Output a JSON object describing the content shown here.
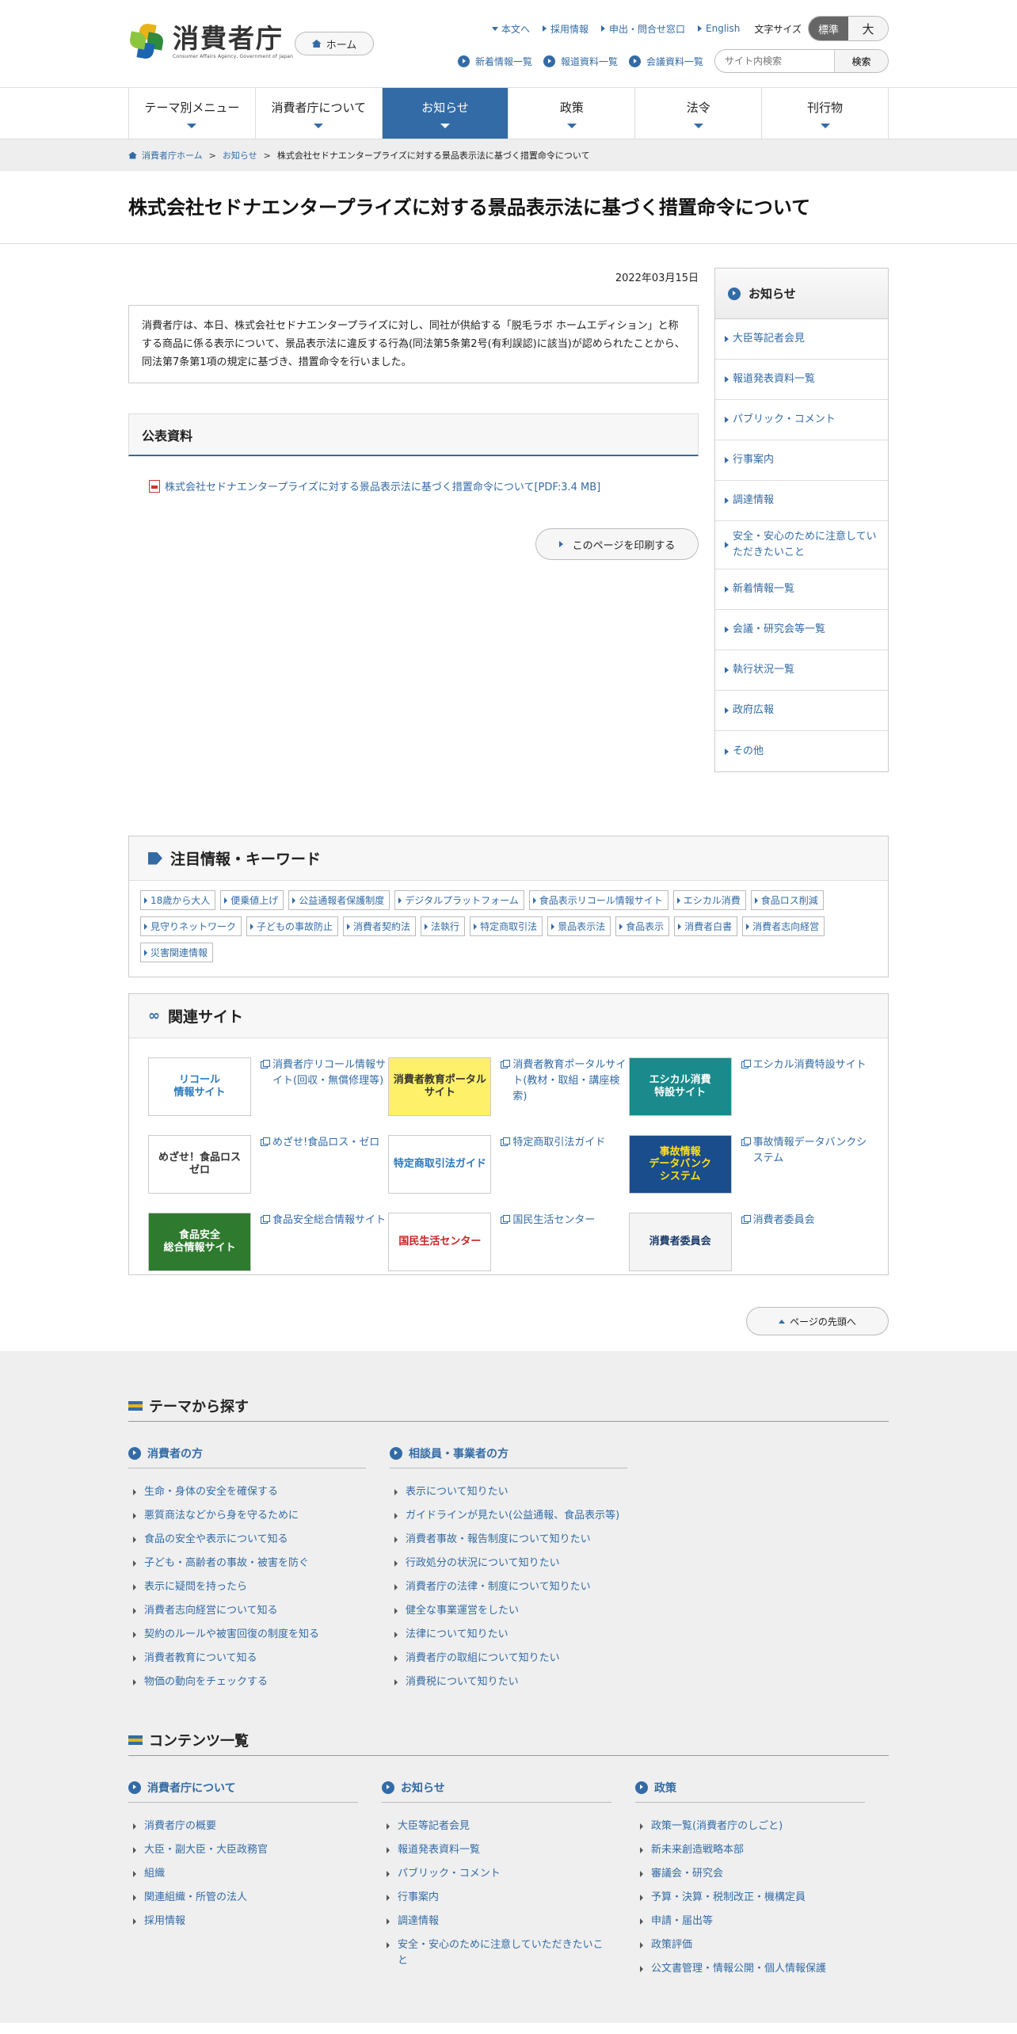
{
  "header": {
    "logo_jp": "消費者庁",
    "logo_en": "Consumer Affairs Agency, Government of Japan",
    "home_label": "ホーム",
    "util_links": [
      "本文へ",
      "採用情報",
      "申出・問合せ窓口",
      "English"
    ],
    "font_size_label": "文字サイズ",
    "font_std": "標準",
    "font_large": "大",
    "sub_links": [
      "新着情報一覧",
      "報道資料一覧",
      "会議資料一覧"
    ],
    "search_placeholder": "サイト内検索",
    "search_button": "検索"
  },
  "gnav": [
    "テーマ別メニュー",
    "消費者庁について",
    "お知らせ",
    "政策",
    "法令",
    "刊行物"
  ],
  "breadcrumb": {
    "home": "消費者庁ホーム",
    "level2": "お知らせ",
    "current": "株式会社セドナエンタープライズに対する景品表示法に基づく措置命令について"
  },
  "page": {
    "title": "株式会社セドナエンタープライズに対する景品表示法に基づく措置命令について",
    "date": "2022年03月15日",
    "lead": "消費者庁は、本日、株式会社セドナエンタープライズに対し、同社が供給する「脱毛ラボ ホームエディション」と称する商品に係る表示について、景品表示法に違反する行為(同法第5条第2号(有利誤認)に該当)が認められたことから、同法第7条第1項の規定に基づき、措置命令を行いました。",
    "section_title": "公表資料",
    "pdf_link": "株式会社セドナエンタープライズに対する景品表示法に基づく措置命令について[PDF:3.4 MB]",
    "print_label": "このページを印刷する"
  },
  "sidebar": {
    "title": "お知らせ",
    "items": [
      "大臣等記者会見",
      "報道発表資料一覧",
      "パブリック・コメント",
      "行事案内",
      "調達情報",
      "安全・安心のために注意していただきたいこと",
      "新着情報一覧",
      "会議・研究会等一覧",
      "執行状況一覧",
      "政府広報",
      "その他"
    ]
  },
  "keywords": {
    "title": "注目情報・キーワード",
    "items": [
      "18歳から大人",
      "便乗値上げ",
      "公益通報者保護制度",
      "デジタルプラットフォーム",
      "食品表示リコール情報サイト",
      "エシカル消費",
      "食品ロス削減",
      "見守りネットワーク",
      "子どもの事故防止",
      "消費者契約法",
      "法執行",
      "特定商取引法",
      "景品表示法",
      "食品表示",
      "消費者白書",
      "消費者志向経営",
      "災害関連情報"
    ]
  },
  "related": {
    "title": "関連サイト",
    "items": [
      {
        "label": "消費者庁リコール情報サイト(回収・無償修理等)",
        "img": "リコール\n情報サイト",
        "bg": "#ffffff",
        "fg": "#2a7ac0"
      },
      {
        "label": "消費者教育ポータルサイト(教材・取組・講座検索)",
        "img": "消費者教育ポータルサイト",
        "bg": "#fff06a",
        "fg": "#333333"
      },
      {
        "label": "エシカル消費特設サイト",
        "img": "エシカル消費\n特設サイト",
        "bg": "#1a8a8c",
        "fg": "#ffffff"
      },
      {
        "label": "めざせ!食品ロス・ゼロ",
        "img": "めざせ！食品ロス\nゼロ",
        "bg": "#ffffff",
        "fg": "#333333"
      },
      {
        "label": "特定商取引法ガイド",
        "img": "特定商取引法ガイド",
        "bg": "#ffffff",
        "fg": "#2a7ac0"
      },
      {
        "label": "事故情報データバンクシステム",
        "img": "事故情報\nデータバンク\nシステム",
        "bg": "#1a4d8c",
        "fg": "#ffe020"
      },
      {
        "label": "食品安全総合情報サイト",
        "img": "食品安全\n総合情報サイト",
        "bg": "#2e7a2e",
        "fg": "#ffffff"
      },
      {
        "label": "国民生活センター",
        "img": "国民生活センター",
        "bg": "#ffffff",
        "fg": "#cc2222"
      },
      {
        "label": "消費者委員会",
        "img": "消費者委員会",
        "bg": "#f4f4f4",
        "fg": "#1a3a6a"
      }
    ]
  },
  "pagetop_label": "ページの先頭へ",
  "footer": {
    "theme_title": "テーマから探す",
    "theme_cols": [
      {
        "title": "消費者の方",
        "items": [
          "生命・身体の安全を確保する",
          "悪質商法などから身を守るために",
          "食品の安全や表示について知る",
          "子ども・高齢者の事故・被害を防ぐ",
          "表示に疑問を持ったら",
          "消費者志向経営について知る",
          "契約のルールや被害回復の制度を知る",
          "消費者教育について知る",
          "物価の動向をチェックする"
        ]
      },
      {
        "title": "相談員・事業者の方",
        "items": [
          "表示について知りたい",
          "ガイドラインが見たい(公益通報、食品表示等)",
          "消費者事故・報告制度について知りたい",
          "行政処分の状況について知りたい",
          "消費者庁の法律・制度について知りたい",
          "健全な事業運営をしたい",
          "法律について知りたい",
          "消費者庁の取組について知りたい",
          "消費税について知りたい"
        ]
      }
    ],
    "contents_title": "コンテンツ一覧",
    "contents_cols": [
      {
        "title": "消費者庁について",
        "items": [
          "消費者庁の概要",
          "大臣・副大臣・大臣政務官",
          "組織",
          "関連組織・所管の法人",
          "採用情報"
        ]
      },
      {
        "title": "お知らせ",
        "items": [
          "大臣等記者会見",
          "報道発表資料一覧",
          "パブリック・コメント",
          "行事案内",
          "調達情報",
          "安全・安心のために注意していただきたいこと"
        ]
      },
      {
        "title": "政策",
        "items": [
          "政策一覧(消費者庁のしごと)",
          "新未来創造戦略本部",
          "審議会・研究会",
          "予算・決算・税制改正・機構定員",
          "申請・届出等",
          "政策評価",
          "公文書管理・情報公開・個人情報保護"
        ]
      }
    ]
  }
}
